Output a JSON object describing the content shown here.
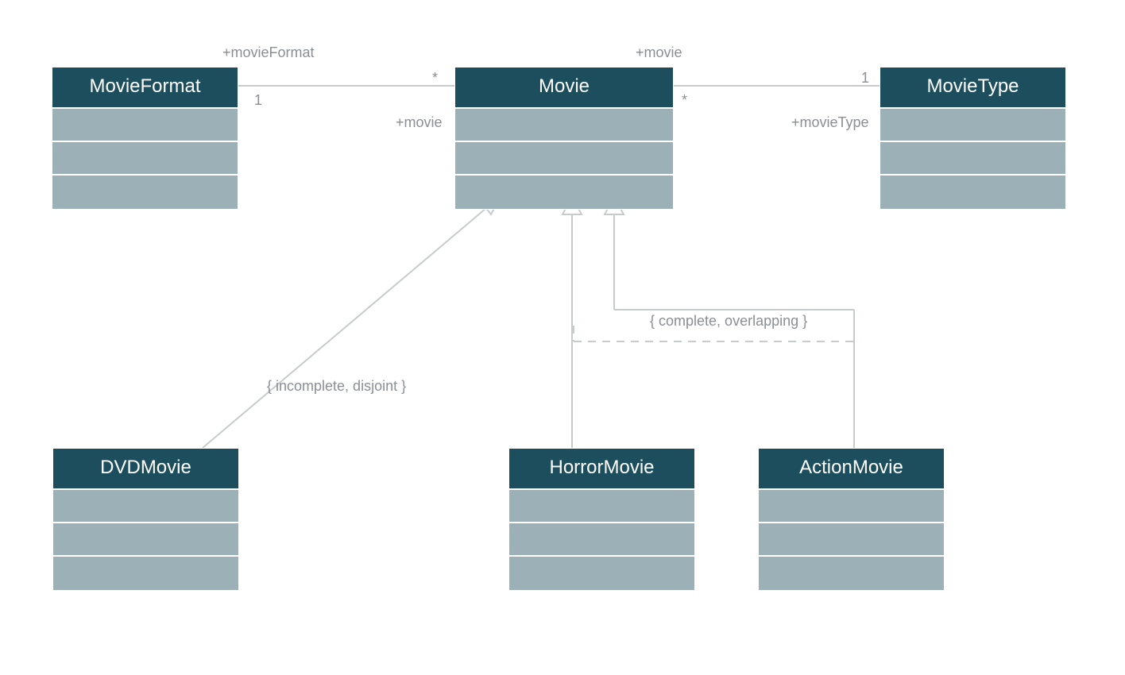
{
  "classes": {
    "movieFormat": {
      "name": "MovieFormat"
    },
    "movie": {
      "name": "Movie"
    },
    "movieType": {
      "name": "MovieType"
    },
    "dvdMovie": {
      "name": "DVDMovie"
    },
    "horrorMovie": {
      "name": "HorrorMovie"
    },
    "actionMovie": {
      "name": "ActionMovie"
    }
  },
  "labels": {
    "movieFormatRole": "+movieFormat",
    "movieRoleL": "+movie",
    "movieRoleR": "+movie",
    "movieTypeRole": "+movieType",
    "multStar1": "*",
    "multOne1": "1",
    "multStar2": "*",
    "multOne2": "1"
  },
  "constraints": {
    "left": "{ incomplete, disjoint }",
    "right": "{ complete, overlapping }"
  },
  "colors": {
    "header": "#1d4e5e",
    "row": "#9bb0b7",
    "line": "#c7cbcc",
    "text": "#8a8f94"
  }
}
